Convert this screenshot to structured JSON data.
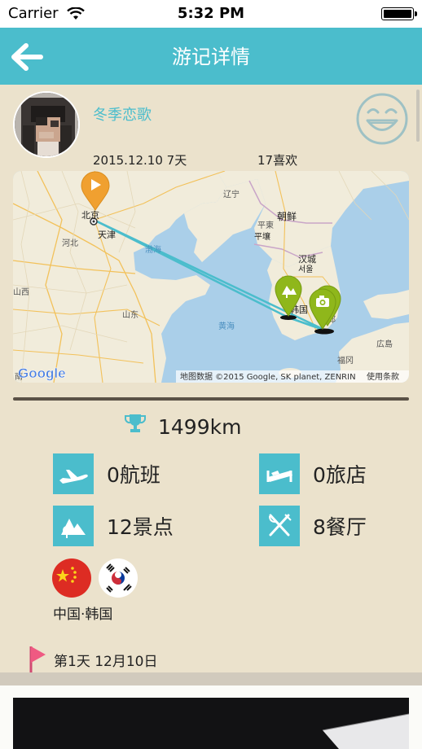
{
  "status_bar": {
    "carrier": "Carrier",
    "time": "5:32 PM",
    "battery_level": 1.0
  },
  "nav": {
    "title": "游记详情",
    "back_icon": "arrow-left-icon"
  },
  "author": {
    "name": "冬季恋歌"
  },
  "trip": {
    "date_duration": "2015.12.10 7天",
    "likes": "17喜欢"
  },
  "map": {
    "labels": {
      "beijing": "北京",
      "tianjin": "天津",
      "hebei": "河北",
      "shandong": "山东",
      "bohai": "渤海",
      "yellow_sea": "黄海",
      "liaoning": "辽宁",
      "korea": "朝鲜",
      "pyongyang": "平壤",
      "pingdong": "平東",
      "seoul": "汉城",
      "seoul2": "서울",
      "south_korea": "韩国",
      "fukuoka": "福冈",
      "hiroshima": "広島",
      "shanxi": "山西",
      "daegu": "大邱",
      "nan": "南"
    },
    "brand": "Google",
    "attribution": "地图数据 ©2015 Google, SK planet, ZENRIN",
    "terms": "使用条款"
  },
  "stats": {
    "distance": "1499km",
    "flights": "0航班",
    "hotels": "0旅店",
    "sights": "12景点",
    "restaurants": "8餐厅"
  },
  "countries": {
    "label": "中国·韩国"
  },
  "day": {
    "label": "第1天 12月10日"
  },
  "colors": {
    "accent": "#4bbdcc",
    "background": "#ebe2cc",
    "pin_orange": "#f0a030",
    "pin_green": "#8fb71b"
  }
}
